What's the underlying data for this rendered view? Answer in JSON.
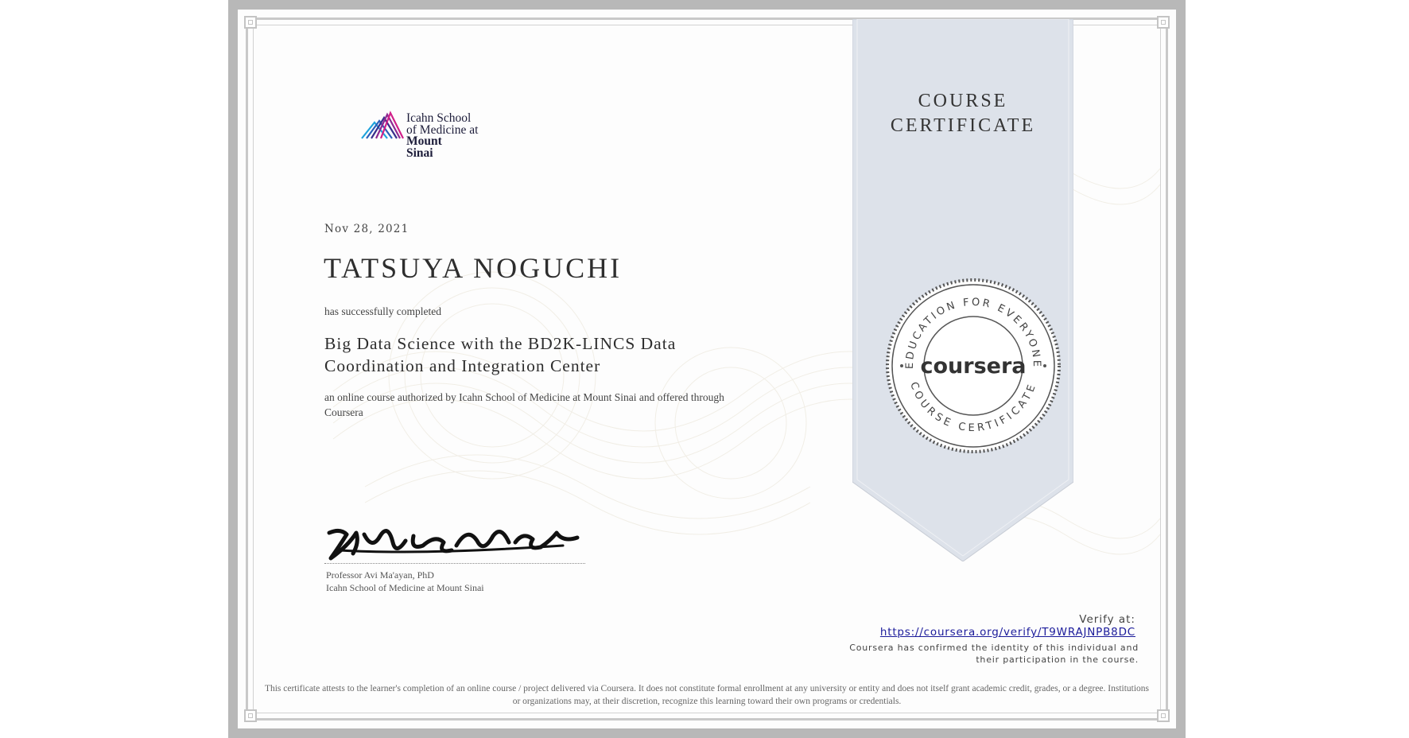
{
  "institution": {
    "logo_lines": [
      "Icahn School",
      "of Medicine at",
      "Mount",
      "Sinai"
    ]
  },
  "certificate": {
    "date": "Nov 28, 2021",
    "recipient_name": "TATSUYA NOGUCHI",
    "completed_text": "has successfully completed",
    "course_title": "Big Data Science with the BD2K-LINCS Data Coordination and Integration Center",
    "authorized_text": "an online course authorized by Icahn School of Medicine at Mount Sinai and offered through Coursera"
  },
  "signer": {
    "name": "Professor Avi Ma'ayan, PhD",
    "affiliation": "Icahn School of Medicine at Mount Sinai"
  },
  "ribbon": {
    "line1": "COURSE",
    "line2": "CERTIFICATE"
  },
  "seal": {
    "brand": "coursera",
    "top_arc": "EDUCATION FOR EVERYONE",
    "bottom_arc": "COURSE CERTIFICATE"
  },
  "verify": {
    "label": "Verify at:",
    "url": "https://coursera.org/verify/T9WRAJNPB8DC",
    "note": "Coursera has confirmed the identity of this individual and their participation in the course."
  },
  "disclaimer": "This certificate attests to the learner's completion of an online course / project delivered via Coursera. It does not constitute formal enrollment at any university or entity and does not itself grant academic credit, grades, or a degree. Institutions or organizations may, at their discretion, recognize this learning toward their own programs or credentials.",
  "colors": {
    "ribbon_fill": "#dde2ea",
    "frame": "#b8b8b8",
    "link": "#1a1a9a",
    "logo_cyan": "#1fa3dc",
    "logo_blue": "#2c3e9c",
    "logo_magenta": "#d1208a"
  }
}
